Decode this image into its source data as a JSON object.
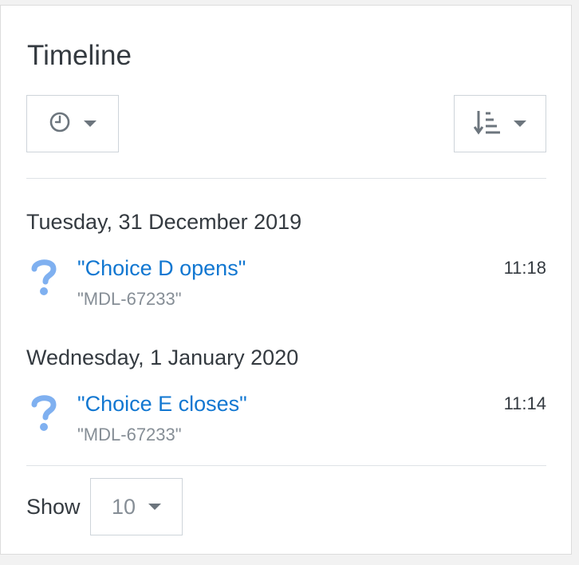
{
  "block": {
    "title": "Timeline"
  },
  "filter_button": {
    "icon": "clock-icon"
  },
  "sort_button": {
    "icon": "sort-amount-down-icon"
  },
  "groups": [
    {
      "date": "Tuesday, 31 December 2019",
      "events": [
        {
          "icon": "question-icon",
          "title": "\"Choice D opens\"",
          "course": "\"MDL-67233\"",
          "time": "11:18"
        }
      ]
    },
    {
      "date": "Wednesday, 1 January 2020",
      "events": [
        {
          "icon": "question-icon",
          "title": "\"Choice E closes\"",
          "course": "\"MDL-67233\"",
          "time": "11:14"
        }
      ]
    }
  ],
  "pagination": {
    "show_label": "Show",
    "per_page": "10"
  },
  "colors": {
    "link": "#1177d1",
    "muted": "#868e96",
    "text": "#343a40",
    "icon_blue": "#7fb0f0"
  }
}
